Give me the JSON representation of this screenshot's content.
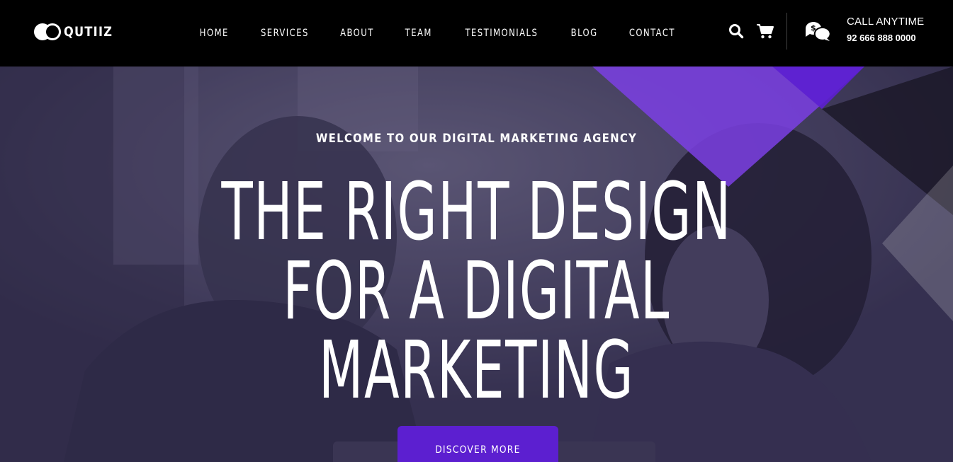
{
  "brand": {
    "name": "QUTIIZ"
  },
  "nav": {
    "items": [
      {
        "label": "HOME"
      },
      {
        "label": "SERVICES"
      },
      {
        "label": "ABOUT"
      },
      {
        "label": "TEAM"
      },
      {
        "label": "TESTIMONIALS"
      },
      {
        "label": "BLOG"
      },
      {
        "label": "CONTACT"
      }
    ]
  },
  "header": {
    "search_icon": "search-icon",
    "cart_icon": "cart-icon",
    "chat_icon": "chat-dollar-icon",
    "call_label": "CALL ANYTIME",
    "call_number": "92 666 888 0000"
  },
  "hero": {
    "eyebrow": "WELCOME TO OUR DIGITAL MARKETING AGENCY",
    "headline_lines": [
      "THE RIGHT DESIGN",
      "FOR A DIGITAL",
      "MARKETING"
    ],
    "cta_label": "DISCOVER MORE"
  },
  "colors": {
    "header_bg": "#000000",
    "accent": "#5c1fd0",
    "accent_light": "#7b3fe4",
    "text": "#ffffff"
  }
}
